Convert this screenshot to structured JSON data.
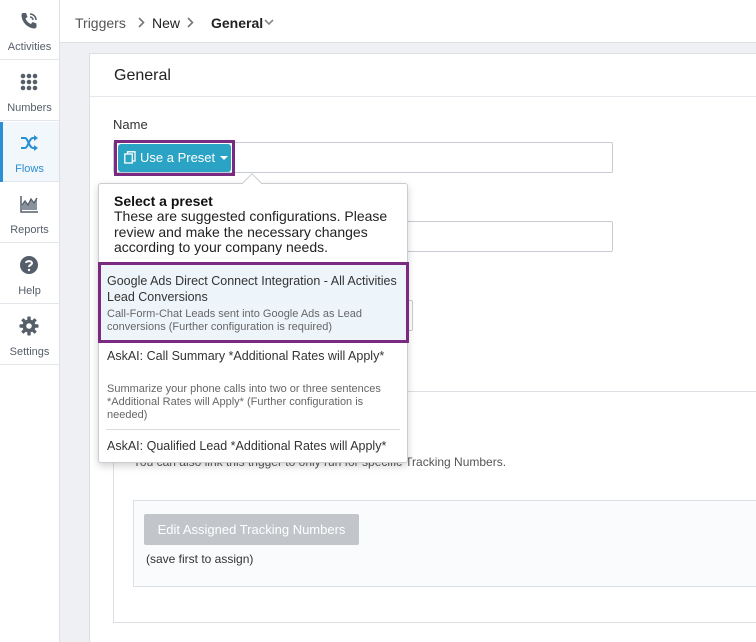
{
  "sidebar": {
    "items": [
      {
        "label": "Activities",
        "icon": "phone-icon"
      },
      {
        "label": "Numbers",
        "icon": "grid-dots-icon"
      },
      {
        "label": "Flows",
        "icon": "shuffle-icon",
        "active": true
      },
      {
        "label": "Reports",
        "icon": "chart-icon"
      },
      {
        "label": "Help",
        "icon": "help-icon"
      },
      {
        "label": "Settings",
        "icon": "gear-icon"
      }
    ]
  },
  "breadcrumb": {
    "items": [
      "Triggers",
      "New",
      "General"
    ]
  },
  "card": {
    "title": "General",
    "name_label": "Name",
    "preset_button_label": "Use a Preset",
    "hint_text": "You can also link this trigger to only run for specific Tracking Numbers.",
    "edit_button_label": "Edit Assigned Tracking Numbers",
    "save_note": "(save first to assign)"
  },
  "preset_popover": {
    "title": "Select a preset",
    "description": "These are suggested configurations. Please review and make the necessary changes according to your company needs.",
    "options": [
      {
        "title": "Google Ads Direct Connect Integration - All Activities Lead Conversions",
        "description": "Call-Form-Chat Leads sent into Google Ads as Lead conversions (Further configuration is required)"
      },
      {
        "title": "AskAI: Call Summary *Additional Rates will Apply*",
        "description": "Summarize your phone calls into two or three sentences *Additional Rates will Apply* (Further configuration is needed)"
      },
      {
        "title": "AskAI: Qualified Lead *Additional Rates will Apply*",
        "description": ""
      }
    ]
  },
  "colors": {
    "accent": "#2b8fd4",
    "preset_button": "#2ba3c4",
    "highlight": "#7a2a80"
  }
}
